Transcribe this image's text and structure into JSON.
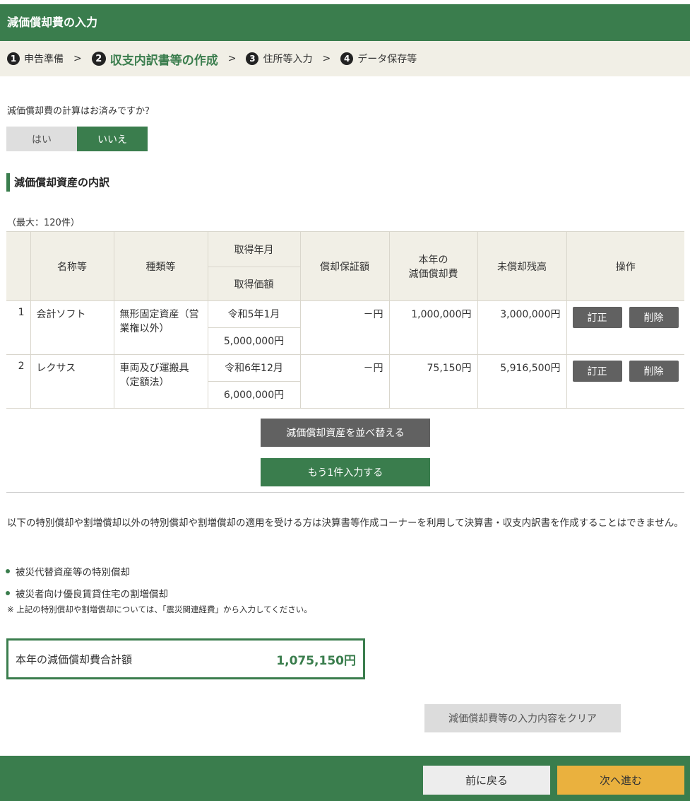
{
  "header": {
    "title": "減価償却費の入力"
  },
  "steps": [
    {
      "num": "1",
      "label": "申告準備"
    },
    {
      "num": "2",
      "label": "収支内訳書等の作成"
    },
    {
      "num": "3",
      "label": "住所等入力"
    },
    {
      "num": "4",
      "label": "データ保存等"
    }
  ],
  "chevron": ">",
  "question": {
    "text": "減価償却費の計算はお済みですか？",
    "yes_label": "はい",
    "no_label": "いいえ",
    "selected": "いいえ"
  },
  "section": {
    "title": "減価償却資産の内訳",
    "max_note": "（最大：120件）"
  },
  "table": {
    "headers": {
      "name": "名称等",
      "type": "種類等",
      "acq_date": "取得年月",
      "acq_price": "取得価額",
      "guarantee": "償却保証額",
      "depr_line1": "本年の",
      "depr_line2": "減価償却費",
      "remaining": "未償却残高",
      "ops": "操作"
    },
    "rows": [
      {
        "idx": "1",
        "name": "会計ソフト",
        "type": "無形固定資産（営業権以外）",
        "acq_date": "令和5年1月",
        "acq_price": "5,000,000円",
        "guarantee": "－円",
        "depr": "1,000,000円",
        "remaining": "3,000,000円",
        "edit": "訂正",
        "delete": "削除"
      },
      {
        "idx": "2",
        "name": "レクサス",
        "type": "車両及び運搬具（定額法）",
        "acq_date": "令和6年12月",
        "acq_price": "6,000,000円",
        "guarantee": "－円",
        "depr": "75,150円",
        "remaining": "5,916,500円",
        "edit": "訂正",
        "delete": "削除"
      }
    ]
  },
  "buttons": {
    "sort": "減価償却資産を並べ替える",
    "add": "もう1件入力する",
    "clear": "減価償却費等の入力内容をクリア",
    "back": "前に戻る",
    "next": "次へ進む"
  },
  "notice": {
    "paragraph": "以下の特別償却や割増償却以外の特別償却や割増償却の適用を受ける方は決算書等作成コーナーを利用して決算書・収支内訳書を作成することはできません。",
    "bullets": [
      "被災代替資産等の特別償却",
      "被災者向け優良賃貸住宅の割増償却"
    ],
    "footnote": "※ 上記の特別償却や割増償却については、「震災関連経費」から入力してください。"
  },
  "total": {
    "label": "本年の減価償却費合計額",
    "value": "1,075,150円"
  },
  "colors": {
    "brand_green": "#3a7d4d",
    "next_yellow": "#eab13e",
    "op_gray": "#616161"
  }
}
